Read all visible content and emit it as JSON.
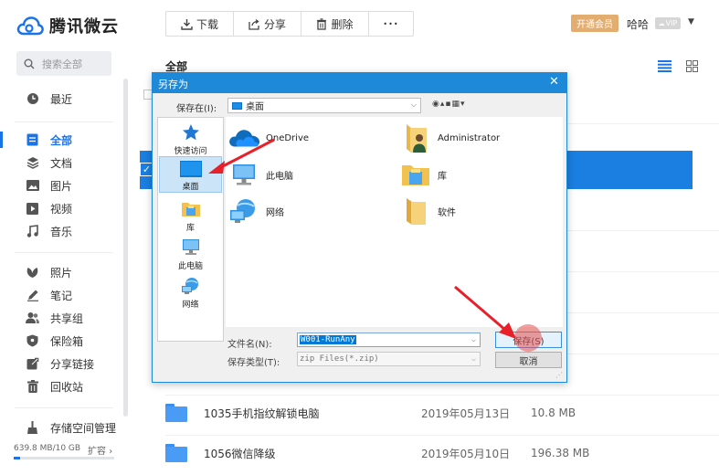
{
  "app": {
    "brand": "腾讯微云",
    "search_placeholder": "搜索全部"
  },
  "sidebar": {
    "items": [
      {
        "label": "最近",
        "icon": "clock-icon"
      },
      {
        "label": "全部",
        "icon": "file-icon",
        "active": true
      },
      {
        "label": "文档",
        "icon": "layers-icon"
      },
      {
        "label": "图片",
        "icon": "image-icon"
      },
      {
        "label": "视频",
        "icon": "play-icon"
      },
      {
        "label": "音乐",
        "icon": "music-icon"
      },
      {
        "label": "照片",
        "icon": "leaf-icon"
      },
      {
        "label": "笔记",
        "icon": "pen-icon"
      },
      {
        "label": "共享组",
        "icon": "people-icon"
      },
      {
        "label": "保险箱",
        "icon": "shield-icon"
      },
      {
        "label": "分享链接",
        "icon": "share-icon"
      },
      {
        "label": "回收站",
        "icon": "trash-icon"
      }
    ],
    "storage": {
      "label": "存储空间管理",
      "usage": "639.8 MB/10 GB",
      "expand": "扩容",
      "used_fraction": 0.0625
    }
  },
  "toolbar": {
    "download": "下载",
    "share": "分享",
    "delete": "删除",
    "more": "•••"
  },
  "user": {
    "vip_button": "开通会员",
    "name": "哈哈",
    "badge": "VIP"
  },
  "main": {
    "title": "全部",
    "files": [
      {
        "name": "1035手机指纹解锁电脑",
        "date": "2019年05月13日",
        "size": "10.8 MB"
      },
      {
        "name": "1056微信降级",
        "date": "2019年05月10日",
        "size": "196.38 MB"
      }
    ]
  },
  "dialog": {
    "title": "另存为",
    "close": "✕",
    "save_in_label": "保存在(I):",
    "save_in_value": "桌面",
    "places": [
      {
        "label": "快速访问"
      },
      {
        "label": "桌面",
        "selected": true
      },
      {
        "label": "库"
      },
      {
        "label": "此电脑"
      },
      {
        "label": "网络"
      }
    ],
    "items": [
      {
        "label": "OneDrive"
      },
      {
        "label": "Administrator"
      },
      {
        "label": "此电脑"
      },
      {
        "label": "库"
      },
      {
        "label": "网络"
      },
      {
        "label": "软件"
      }
    ],
    "filename_label": "文件名(N):",
    "filename_value": "W001-RunAny",
    "filetype_label": "保存类型(T):",
    "filetype_value": "zip Files(*.zip)",
    "save_button": "保存(S)",
    "cancel_button": "取消"
  },
  "colors": {
    "accent": "#1a73e8",
    "dialog_title": "#1d89d8",
    "vip": "#e3ad6f",
    "annotation": "#e8202a"
  }
}
